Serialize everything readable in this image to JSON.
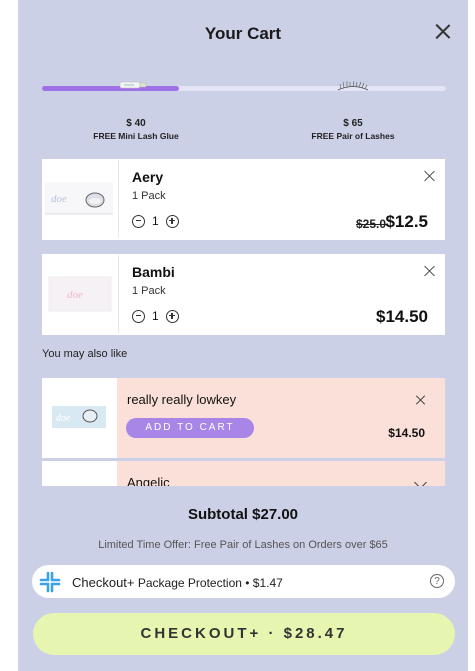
{
  "header": {
    "title": "Your Cart"
  },
  "progress": {
    "fraction": 0.34,
    "accent_color": "#9e72e6",
    "milestones": [
      {
        "amount": "$ 40",
        "reward": "FREE Mini Lash Glue",
        "icon": "lash-glue-icon"
      },
      {
        "amount": "$ 65",
        "reward": "FREE Pair of Lashes",
        "icon": "lashes-icon"
      }
    ]
  },
  "cart": {
    "items": [
      {
        "name": "Aery",
        "pack": "1 Pack",
        "quantity": "1",
        "old_price": "$25.0",
        "price": "$12.5"
      },
      {
        "name": "Bambi",
        "pack": "1 Pack",
        "quantity": "1",
        "price": "$14.50"
      }
    ]
  },
  "recommendations": {
    "heading": "You may also like",
    "items": [
      {
        "name": "really really lowkey",
        "button": "ADD TO CART",
        "price": "$14.50"
      },
      {
        "name": "Angelic"
      }
    ]
  },
  "footer": {
    "subtotal": "Subtotal $27.00",
    "offer": "Limited Time Offer: Free Pair of Lashes on Orders over $65",
    "protection": {
      "brand": "Checkout+",
      "label": "Package Protection",
      "price": "• $1.47",
      "help": "?"
    },
    "checkout_label": "CHECKOUT+ · $28.47",
    "checkout_color": "#e6f6b0"
  }
}
